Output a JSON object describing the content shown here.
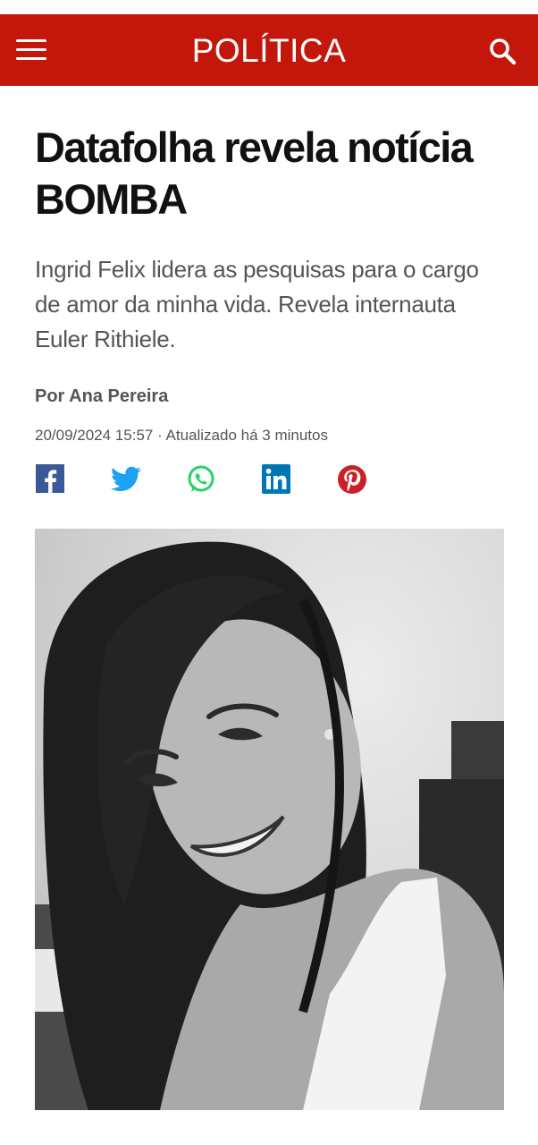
{
  "header": {
    "section_title": "POLÍTICA",
    "menu_icon": "hamburger-menu-icon",
    "search_icon": "search-icon",
    "color": "#c4170c"
  },
  "article": {
    "headline": "Datafolha revela notícia BOMBA",
    "subtitle": "Ingrid Felix lidera as pesquisas para o cargo de amor da minha vida. Revela internauta Euler Rithiele.",
    "byline": "Por Ana Pereira",
    "meta": "20/09/2024 15:57 · Atualizado há 3 minutos"
  },
  "share": [
    {
      "name": "facebook-icon",
      "color": "#3b5998"
    },
    {
      "name": "twitter-icon",
      "color": "#1da1f2"
    },
    {
      "name": "whatsapp-icon",
      "color": "#25d366"
    },
    {
      "name": "linkedin-icon",
      "color": "#0077b5"
    },
    {
      "name": "pinterest-icon",
      "color": "#cb2027"
    }
  ],
  "photo": {
    "style": "black-and-white portrait of a smiling woman with long dark hair"
  }
}
